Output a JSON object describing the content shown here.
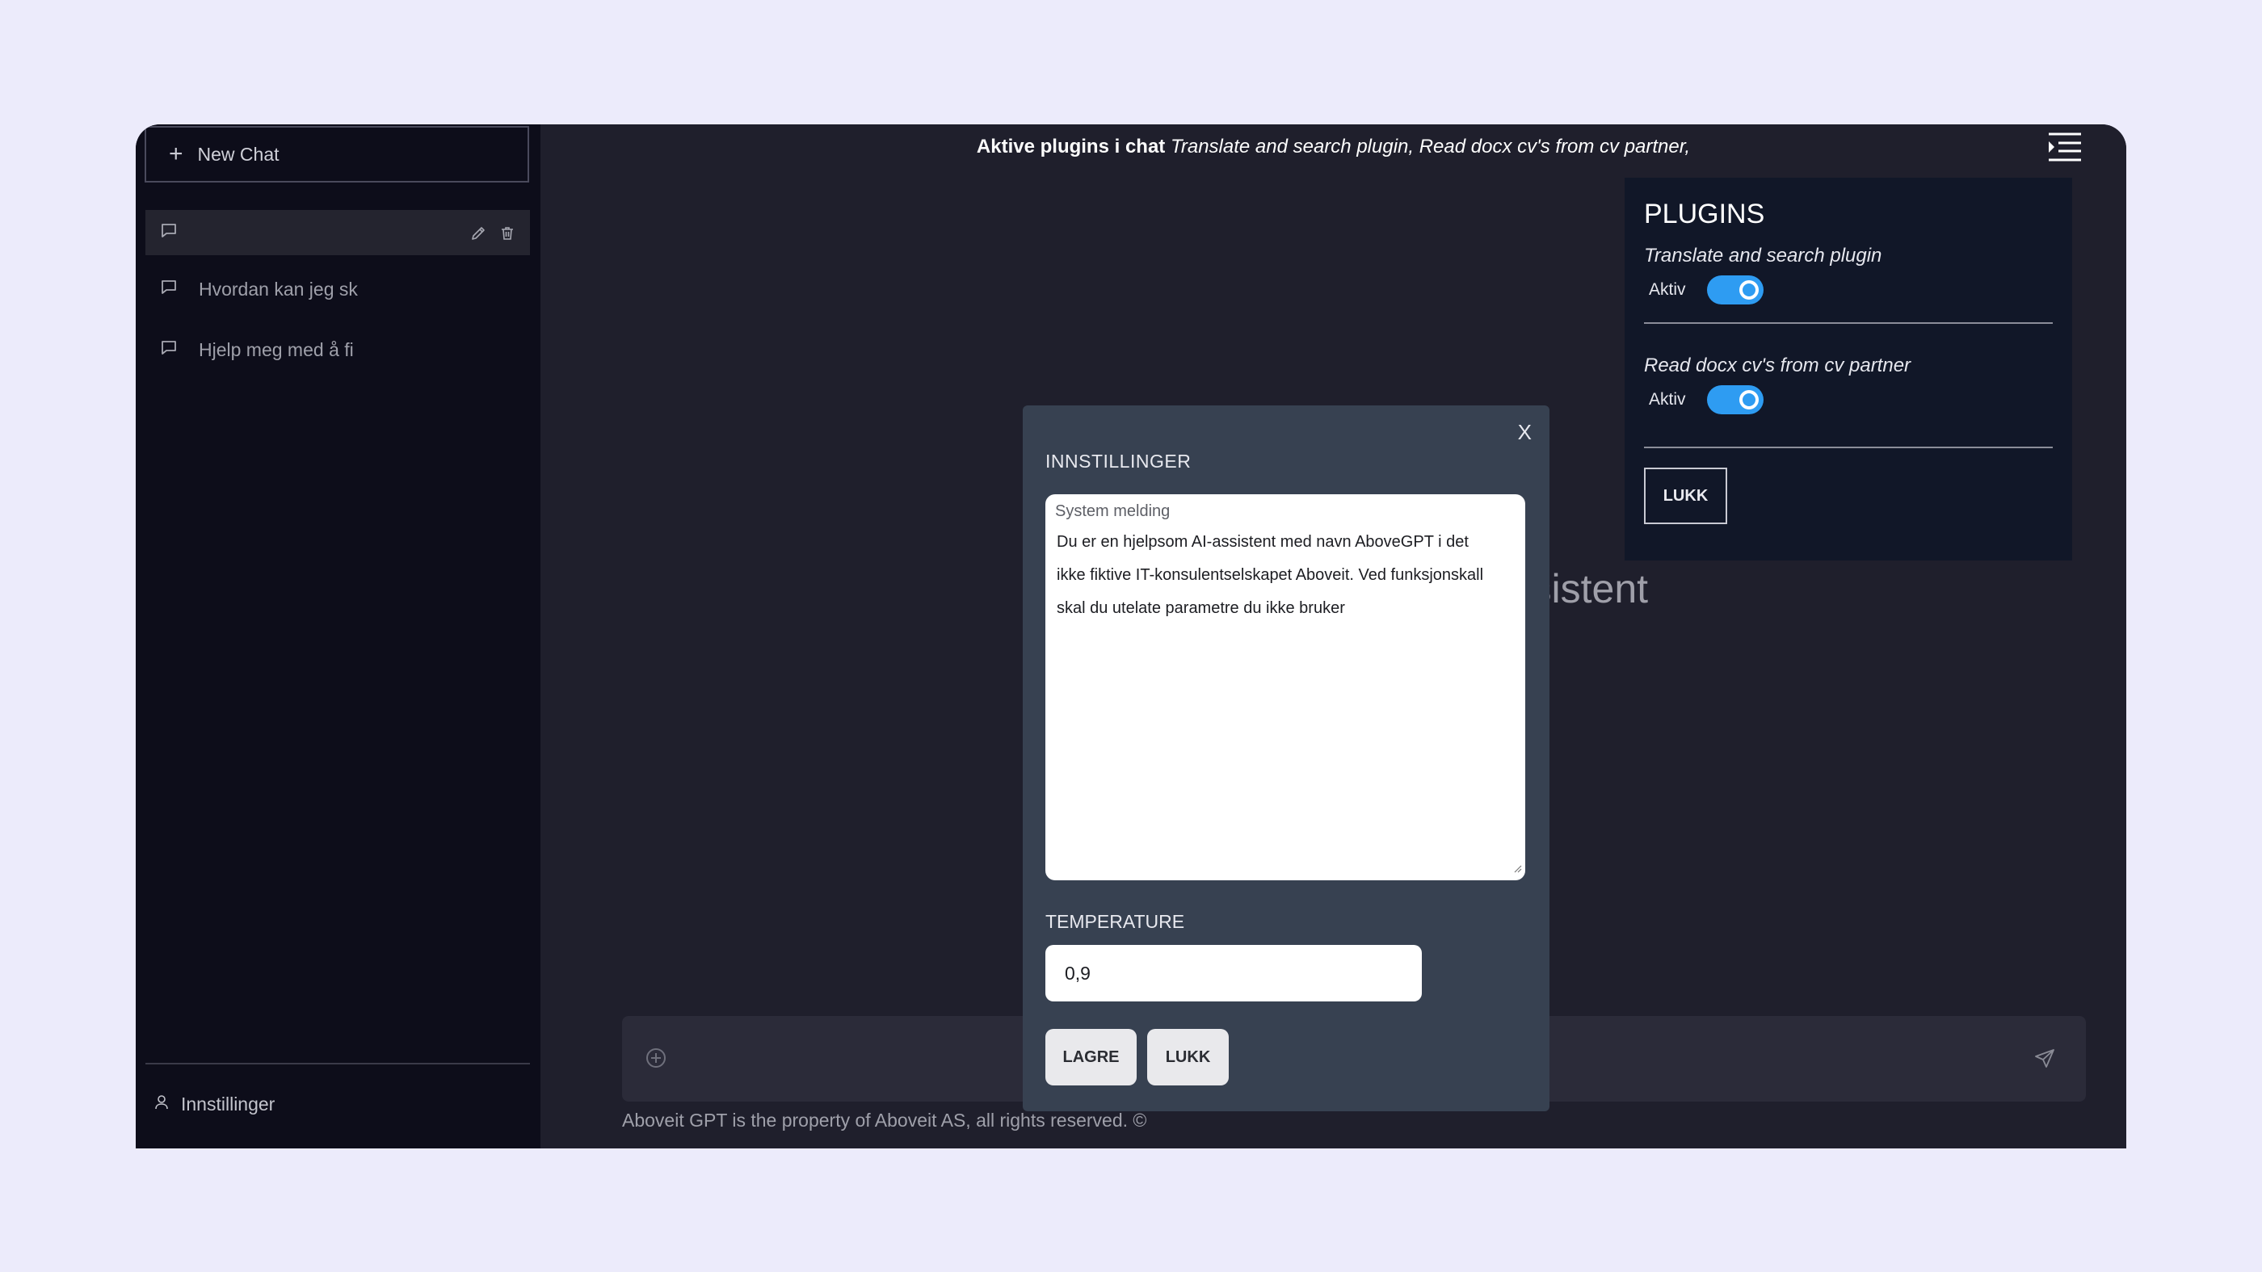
{
  "sidebar": {
    "new_chat_label": "New Chat",
    "conversations": [
      {
        "title": ""
      },
      {
        "title": "Hvordan kan jeg sk"
      },
      {
        "title": "Hjelp meg med å fi"
      }
    ],
    "settings_label": "Innstillinger"
  },
  "header": {
    "active_label": "Aktive plugins i chat",
    "active_plugins": "Translate and search plugin, Read docx cv's from cv partner,"
  },
  "main": {
    "hero_text": "eidsassistent",
    "footer_text": "Aboveit GPT is the property of Aboveit AS, all rights reserved. ©"
  },
  "plugins": {
    "title": "PLUGINS",
    "items": [
      {
        "name": "Translate and search plugin",
        "status_label": "Aktiv",
        "enabled": true
      },
      {
        "name": "Read docx cv's from cv partner",
        "status_label": "Aktiv",
        "enabled": true
      }
    ],
    "close_label": "LUKK"
  },
  "settings_modal": {
    "close_x": "X",
    "title": "INNSTILLINGER",
    "system_label": "System melding",
    "system_message": "Du er en hjelpsom AI-assistent med navn AboveGPT i det\nikke fiktive IT-konsulentselskapet Aboveit. Ved funksjonskall\nskal du utelate parametre du ikke bruker",
    "temperature_label": "TEMPERATURE",
    "temperature_value": "0,9",
    "save_label": "LAGRE",
    "close_label": "LUKK"
  },
  "colors": {
    "accent": "#2e9cf2",
    "sidebar_bg": "#0d0d1a",
    "main_bg": "#1f1f2c",
    "modal_bg": "#374151",
    "page_bg": "#ecebfb"
  }
}
